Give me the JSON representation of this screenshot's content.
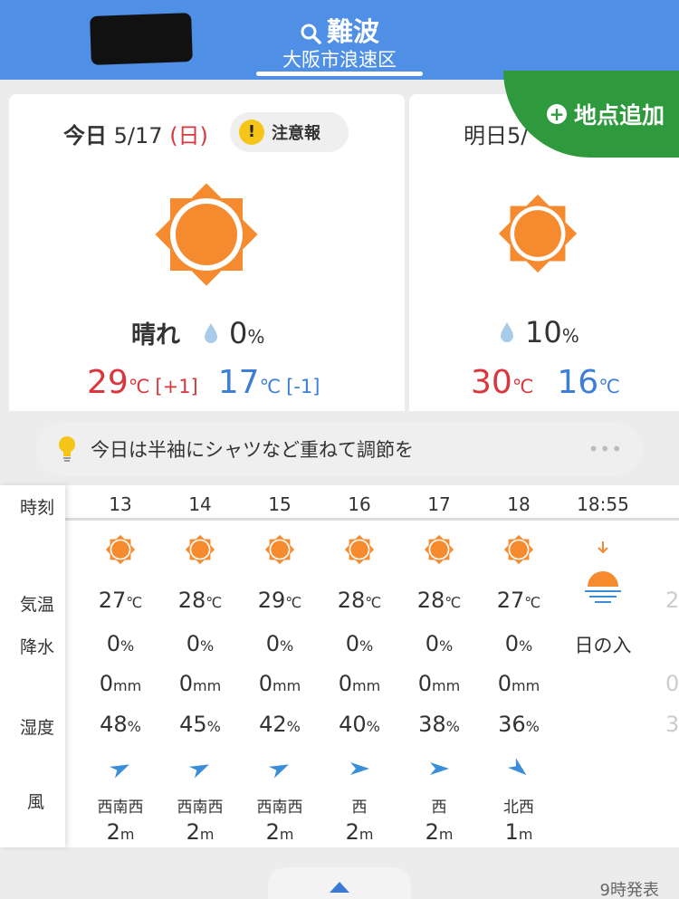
{
  "header": {
    "location": "難波",
    "sublocation": "大阪市浪速区",
    "accent": "#4f8fe6"
  },
  "add_location": {
    "label": "地点追加",
    "color": "#2e9a3d"
  },
  "today": {
    "day": "今日",
    "date": "5/17",
    "weekday": "(日)",
    "alert": "注意報",
    "icon": "sun-icon",
    "condition": "晴れ",
    "precip": "0",
    "precip_unit": "%",
    "high": "29",
    "high_diff": "[+1]",
    "low": "17",
    "low_diff": "[-1]",
    "temp_unit": "℃"
  },
  "tomorrow": {
    "day": "明日",
    "date": "5/",
    "icon": "sun-icon",
    "precip": "10",
    "precip_unit": "%",
    "high": "30",
    "low": "16",
    "temp_unit": "℃"
  },
  "tip": {
    "text": "今日は半袖にシャツなど重ねて調節を",
    "more": "•••"
  },
  "row_labels": {
    "time": "時刻",
    "temp": "気温",
    "precip": "降水",
    "humidity": "湿度",
    "wind": "風"
  },
  "hours": [
    {
      "time": "13",
      "temp": "27",
      "precip": "0",
      "rain": "0",
      "humidity": "48",
      "wind_dir": "西南西",
      "wind_speed": "2",
      "wind_angle": -25
    },
    {
      "time": "14",
      "temp": "28",
      "precip": "0",
      "rain": "0",
      "humidity": "45",
      "wind_dir": "西南西",
      "wind_speed": "2",
      "wind_angle": -25
    },
    {
      "time": "15",
      "temp": "29",
      "precip": "0",
      "rain": "0",
      "humidity": "42",
      "wind_dir": "西南西",
      "wind_speed": "2",
      "wind_angle": -25
    },
    {
      "time": "16",
      "temp": "28",
      "precip": "0",
      "rain": "0",
      "humidity": "40",
      "wind_dir": "西",
      "wind_speed": "2",
      "wind_angle": 0
    },
    {
      "time": "17",
      "temp": "28",
      "precip": "0",
      "rain": "0",
      "humidity": "38",
      "wind_dir": "西",
      "wind_speed": "2",
      "wind_angle": 0
    },
    {
      "time": "18",
      "temp": "27",
      "precip": "0",
      "rain": "0",
      "humidity": "36",
      "wind_dir": "北西",
      "wind_speed": "1",
      "wind_angle": 40
    }
  ],
  "sunset": {
    "time": "18:55",
    "label": "日の入"
  },
  "partial_next": {
    "temp": "2",
    "rain": "0",
    "humidity": "3"
  },
  "units": {
    "temp": "℃",
    "pct": "%",
    "mm": "mm",
    "m": "m"
  },
  "footer": {
    "issued": "9時発表"
  }
}
